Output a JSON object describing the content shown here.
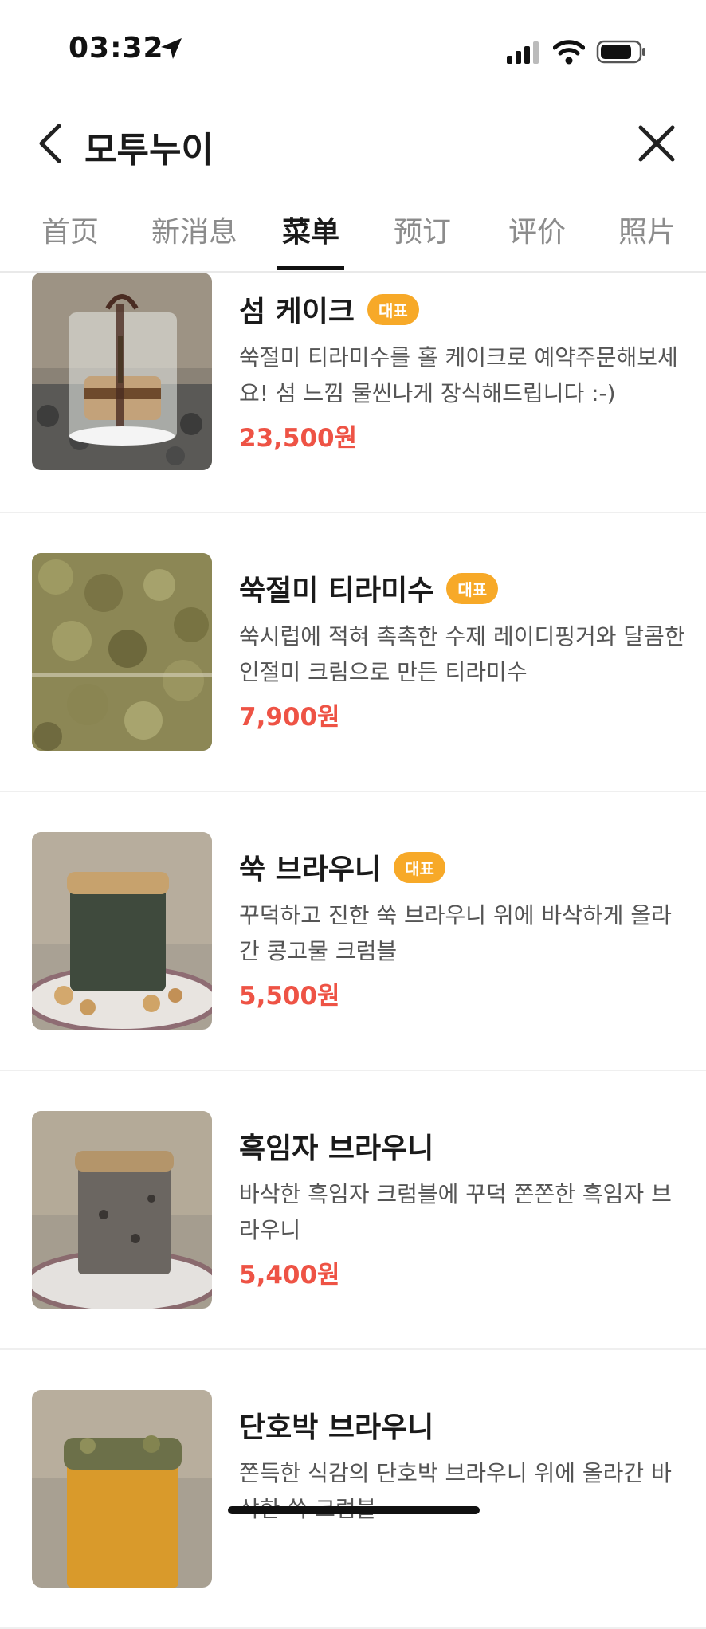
{
  "status_bar": {
    "time": "03:32"
  },
  "header": {
    "title": "모투누이"
  },
  "tabs": [
    {
      "label": "首页",
      "active": false
    },
    {
      "label": "新消息",
      "active": false
    },
    {
      "label": "菜单",
      "active": true
    },
    {
      "label": "预订",
      "active": false
    },
    {
      "label": "评价",
      "active": false
    },
    {
      "label": "照片",
      "active": false
    }
  ],
  "menu_items": [
    {
      "name": "섬 케이크",
      "badge": "대표",
      "desc": "쑥절미 티라미수를 홀 케이크로 예약주문해보세요! 섬 느낌 물씬나게 장식해드립니다 :-)",
      "price": "23,500원"
    },
    {
      "name": "쑥절미 티라미수",
      "badge": "대표",
      "desc": "쑥시럽에 적혀 촉촉한 수제 레이디핑거와 달콤한 인절미 크림으로 만든 티라미수",
      "price": "7,900원"
    },
    {
      "name": "쑥 브라우니",
      "badge": "대표",
      "desc": "꾸덕하고 진한 쑥 브라우니 위에 바삭하게 올라간 콩고물 크럼블",
      "price": "5,500원"
    },
    {
      "name": "흑임자 브라우니",
      "badge": "",
      "desc": "바삭한 흑임자 크럼블에 꾸덕 쫀쫀한 흑임자 브라우니",
      "price": "5,400원"
    },
    {
      "name": "단호박 브라우니",
      "badge": "",
      "desc": "쫀득한 식감의 단호박 브라우니 위에 올라간 바삭한 쑥 크럼블",
      "price": ""
    }
  ],
  "colors": {
    "price": "#ee5345",
    "badge": "#f7a928",
    "active_tab": "#1a1a1a"
  }
}
